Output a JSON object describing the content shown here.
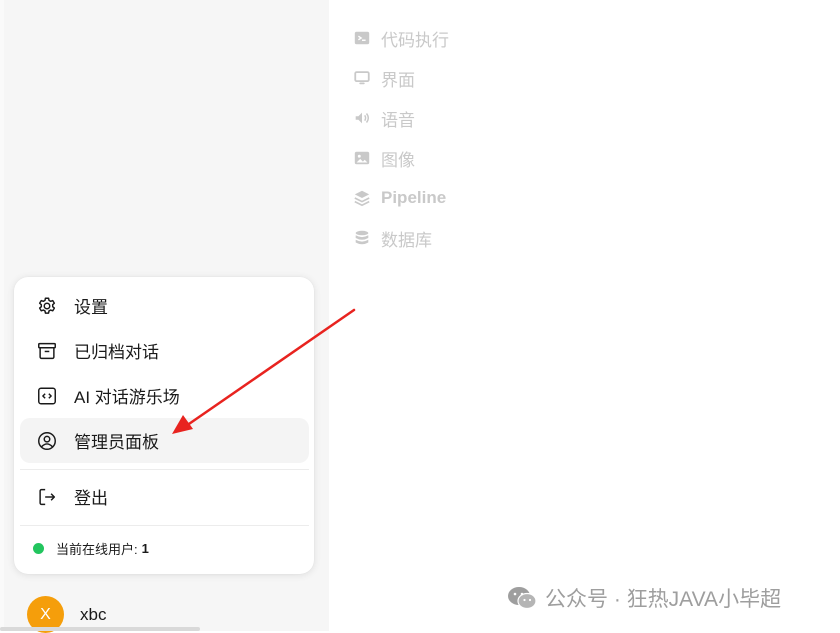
{
  "settings_nav": {
    "items": [
      {
        "icon": "terminal-icon",
        "label": "代码执行"
      },
      {
        "icon": "monitor-icon",
        "label": "界面"
      },
      {
        "icon": "speaker-icon",
        "label": "语音"
      },
      {
        "icon": "image-icon",
        "label": "图像"
      },
      {
        "icon": "layers-icon",
        "label": "Pipeline"
      },
      {
        "icon": "database-icon",
        "label": "数据库"
      }
    ]
  },
  "user_menu": {
    "items": [
      {
        "icon": "gear-icon",
        "label": "设置"
      },
      {
        "icon": "archive-icon",
        "label": "已归档对话"
      },
      {
        "icon": "code-icon",
        "label": "AI 对话游乐场"
      },
      {
        "icon": "user-circle-icon",
        "label": "管理员面板"
      }
    ],
    "logout_label": "登出",
    "online_label": "当前在线用户:",
    "online_count": "1"
  },
  "user": {
    "avatar_initial": "X",
    "name": "xbc"
  },
  "watermark": "公众号 · 狂热JAVA小毕超",
  "colors": {
    "accent_arrow": "#e8231f",
    "avatar": "#f59e0b",
    "online_dot": "#22c55e"
  }
}
